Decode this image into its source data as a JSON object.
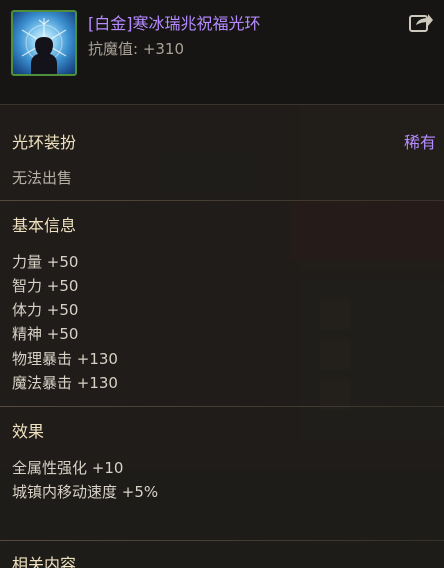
{
  "item": {
    "name": "[白金]寒冰瑞兆祝福光环",
    "stat": "抗魔值: +310",
    "icon": "frost-aura-item-icon",
    "share_icon": "share-icon"
  },
  "aura_section": {
    "title": "光环装扮",
    "rarity": "稀有",
    "trade_note": "无法出售"
  },
  "basic_info": {
    "title": "基本信息",
    "stats": [
      "力量 +50",
      "智力 +50",
      "体力 +50",
      "精神 +50",
      "物理暴击 +130",
      "魔法暴击 +130"
    ]
  },
  "effects": {
    "title": "效果",
    "items": [
      "全属性强化 +10",
      "城镇内移动速度 +5%"
    ]
  },
  "related": {
    "title": "相关内容"
  },
  "colors": {
    "rarity_purple": "#b68cff",
    "section_title": "#f0e2c0",
    "frame_green": "#4e8f3c"
  }
}
